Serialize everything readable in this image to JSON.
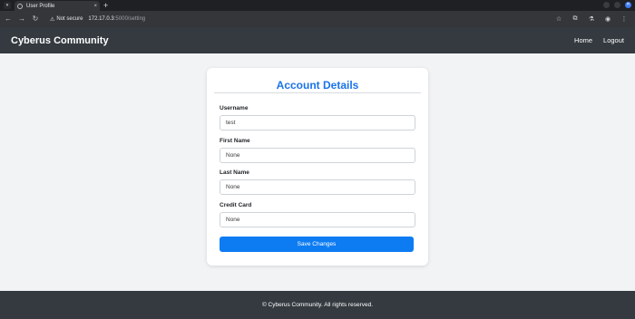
{
  "browser": {
    "tab_title": "User Profile",
    "tab_close": "×",
    "new_tab": "+",
    "address": {
      "security": "Not secure",
      "host": "172.17.0.3",
      "path": ":5000/setting"
    }
  },
  "site": {
    "brand": "Cyberus Community",
    "nav": {
      "home": "Home",
      "logout": "Logout"
    }
  },
  "card": {
    "title": "Account Details",
    "fields": [
      {
        "label": "Username",
        "value": "test"
      },
      {
        "label": "First Name",
        "value": "None"
      },
      {
        "label": "Last Name",
        "value": "None"
      },
      {
        "label": "Credit Card",
        "value": "None"
      }
    ],
    "submit": "Save Changes"
  },
  "footer": {
    "text": "© Cyberus Community. All rights reserved."
  },
  "colors": {
    "navbar": "#343a40",
    "accent": "#0d7cf2",
    "title": "#1a73e8",
    "page_bg": "#f1f3f5"
  }
}
